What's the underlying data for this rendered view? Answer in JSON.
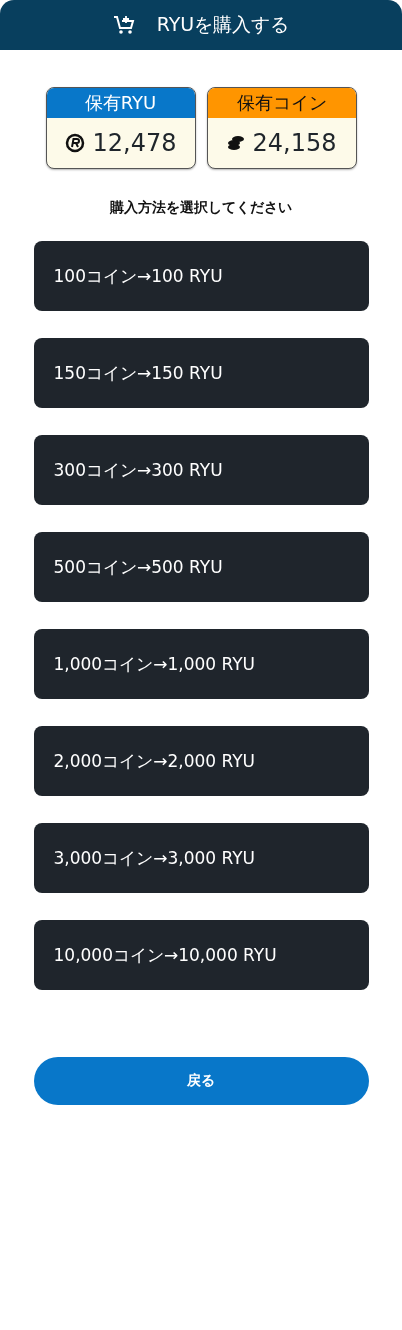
{
  "header": {
    "title": "RYUを購入する"
  },
  "balances": [
    {
      "kind": "ryu",
      "label": "保有RYU",
      "value": "12,478"
    },
    {
      "kind": "coin",
      "label": "保有コイン",
      "value": "24,158"
    }
  ],
  "prompt": "購入方法を選択してください",
  "options": [
    "100コイン→100 RYU",
    "150コイン→150 RYU",
    "300コイン→300 RYU",
    "500コイン→500 RYU",
    "1,000コイン→1,000 RYU",
    "2,000コイン→2,000 RYU",
    "3,000コイン→3,000 RYU",
    "10,000コイン→10,000 RYU"
  ],
  "back_button": "戻る"
}
